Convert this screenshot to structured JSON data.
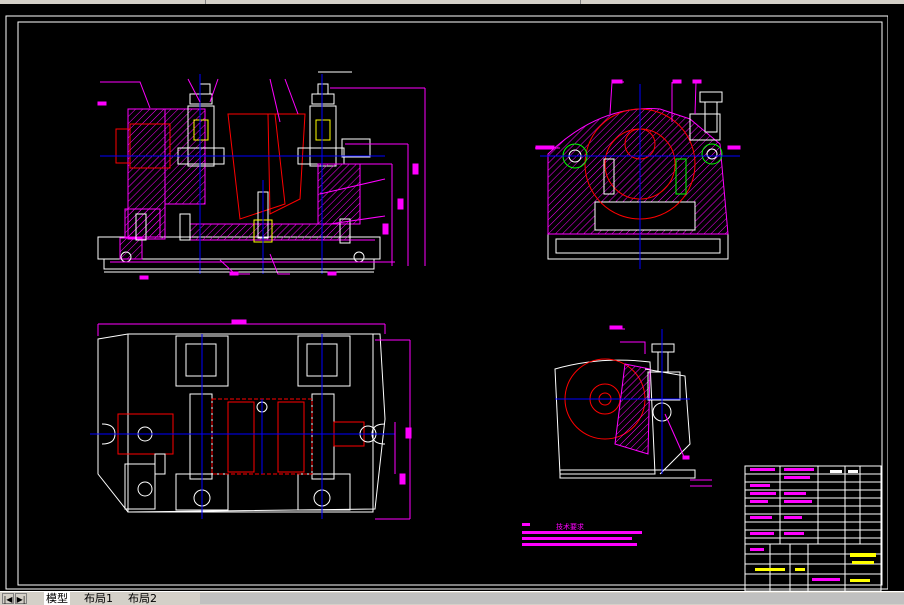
{
  "app": {
    "tabs": [
      {
        "label": "模型",
        "active": true
      },
      {
        "label": "布局1",
        "active": false
      },
      {
        "label": "布局2",
        "active": false
      }
    ],
    "nav_buttons": [
      "|◀",
      "▶|"
    ]
  },
  "drawing": {
    "background": "#000000",
    "colors": {
      "frame": "#ffffff",
      "outline": "#ffffff",
      "dimension": "#ff00ff",
      "center_line": "#0000ff",
      "hatch": "#ff00ff",
      "part_red": "#ff0000",
      "green": "#00ff00",
      "yellow": "#ffff00",
      "cyan": "#00ffff"
    },
    "note_title": "技术要求"
  }
}
